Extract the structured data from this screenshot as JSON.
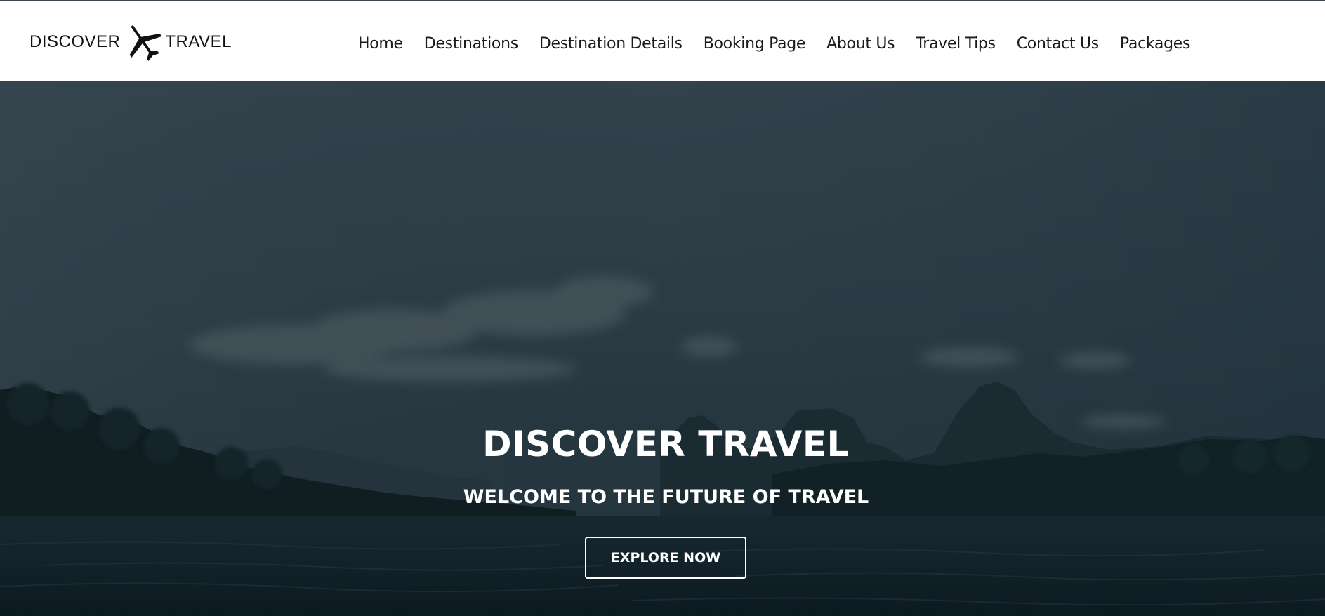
{
  "brand": {
    "word_left": "DISCOVER",
    "word_right": "TRAVEL",
    "icon": "airplane-icon"
  },
  "nav": {
    "items": [
      {
        "label": "Home"
      },
      {
        "label": "Destinations"
      },
      {
        "label": "Destination Details"
      },
      {
        "label": "Booking Page"
      },
      {
        "label": "About Us"
      },
      {
        "label": "Travel Tips"
      },
      {
        "label": "Contact Us"
      },
      {
        "label": "Packages"
      }
    ]
  },
  "hero": {
    "title": "DISCOVER TRAVEL",
    "subtitle": "WELCOME TO THE FUTURE OF TRAVEL",
    "cta_label": "EXPLORE NOW",
    "background": "dark-overlay lake with forested mountains"
  },
  "colors": {
    "header_bg": "#ffffff",
    "nav_text": "#1a1a1a",
    "hero_text": "#ffffff",
    "hero_overlay": "#1c2c36"
  }
}
